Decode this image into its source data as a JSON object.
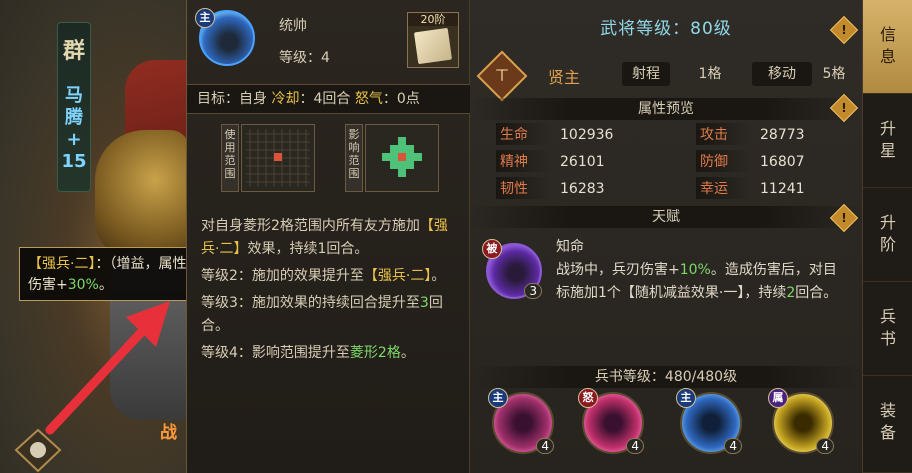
{
  "general": {
    "faction": "群",
    "name_lines": [
      "马",
      "腾",
      "+",
      "15"
    ]
  },
  "tooltip": {
    "head": "【强兵·二】",
    "tail": "：（增益，属性）兵刃伤害、谋略伤害+",
    "value": "30%",
    "end": "。"
  },
  "battle_mark": "战",
  "skill": {
    "role_badge": "主",
    "type": "统帅",
    "level_label": "等级：",
    "level_value": "4",
    "stage_label": "20阶",
    "target_label": "目标：",
    "target_value": "自身",
    "cooldown_label": "冷却",
    "cooldown_value": "：4回合",
    "rage_label": "怒气",
    "rage_value": "：0点",
    "use_range_label": "使用范围",
    "effect_range_label": "影响范围",
    "desc1_a": "对自身菱形2格范围内所有友方施加",
    "desc1_b": "【强兵·二】",
    "desc1_c": "效果，持续",
    "desc1_d": "1回合。",
    "desc2_a": "等级2：施加的效果提升至",
    "desc2_b": "【强兵·二】",
    "desc2_c": "。",
    "desc3_a": "等级3：施加效果的持续回合提升至",
    "desc3_b": "3",
    "desc3_c": "回合。",
    "desc4_a": "等级4：影响范围提升至",
    "desc4_b": "菱形2格",
    "desc4_c": "。"
  },
  "info": {
    "general_level": "武将等级：80级",
    "class_icon": "ㄒ",
    "class_name": "贤主",
    "range_label": "射程",
    "range_value": "1格",
    "move_label": "移动",
    "move_value": "5格",
    "attr_header": "属性预览",
    "attrs": [
      {
        "k": "生命",
        "v": "102936"
      },
      {
        "k": "攻击",
        "v": "28773"
      },
      {
        "k": "精神",
        "v": "26101"
      },
      {
        "k": "防御",
        "v": "16807"
      },
      {
        "k": "韧性",
        "v": "16283"
      },
      {
        "k": "幸运",
        "v": "11241"
      }
    ],
    "talent_header": "天赋",
    "talent_badge": "被",
    "talent_level": "3",
    "talent_name": "知命",
    "talent_desc_a": "战场中，兵刃伤害+",
    "talent_desc_b": "10%",
    "talent_desc_c": "。造成伤害后，对目标施加1个【随机减益效果·一】，持续",
    "talent_desc_d": "2",
    "talent_desc_e": "回合。",
    "bingshu_header": "兵书等级：480/480级",
    "books": [
      {
        "badge": "主",
        "level": "4"
      },
      {
        "badge": "怒",
        "level": "4"
      },
      {
        "badge": "主",
        "level": "4"
      },
      {
        "badge": "属",
        "level": "4"
      }
    ],
    "excl": "!"
  },
  "tabs": [
    "信息",
    "升星",
    "升阶",
    "兵书",
    "装备"
  ],
  "colors": {
    "accent_gold": "#e8c24a",
    "accent_green": "#7ed96b",
    "attr_key": "#e07a4a",
    "level_cyan": "#8fd8e8"
  }
}
